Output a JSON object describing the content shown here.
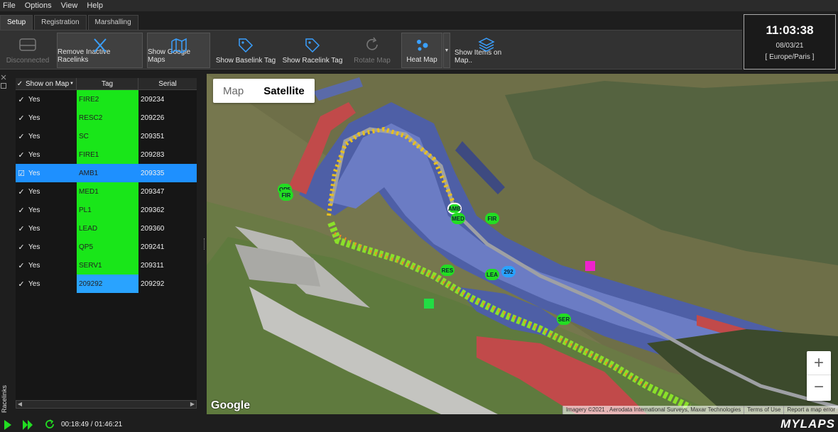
{
  "menu": [
    "File",
    "Options",
    "View",
    "Help"
  ],
  "tabs": [
    "Setup",
    "Registration",
    "Marshalling"
  ],
  "toolbar": {
    "disconnected": "Disconnected",
    "remove_inactive": "Remove Inactive Racelinks",
    "show_google_maps": "Show Google Maps",
    "show_baselink": "Show Baselink Tag",
    "show_racelink": "Show Racelink Tag",
    "rotate_map": "Rotate Map",
    "heat_map": "Heat Map",
    "show_items": "Show Items on Map.."
  },
  "clock": {
    "time": "11:03:38",
    "date": "08/03/21",
    "timezone": "[ Europe/Paris ]"
  },
  "table": {
    "columns": [
      "Show on Map",
      "Tag",
      "Serial"
    ],
    "rows": [
      {
        "show": "Yes",
        "tag": "FIRE2",
        "serial": "209234",
        "tag_color": "#19e619"
      },
      {
        "show": "Yes",
        "tag": "RESC2",
        "serial": "209226",
        "tag_color": "#19e619"
      },
      {
        "show": "Yes",
        "tag": "SC",
        "serial": "209351",
        "tag_color": "#19e619"
      },
      {
        "show": "Yes",
        "tag": "FIRE1",
        "serial": "209283",
        "tag_color": "#19e619"
      },
      {
        "show": "Yes",
        "tag": "AMB1",
        "serial": "209335",
        "tag_color": "#1e90ff",
        "selected": true
      },
      {
        "show": "Yes",
        "tag": "MED1",
        "serial": "209347",
        "tag_color": "#19e619"
      },
      {
        "show": "Yes",
        "tag": "PL1",
        "serial": "209362",
        "tag_color": "#19e619"
      },
      {
        "show": "Yes",
        "tag": "LEAD",
        "serial": "209360",
        "tag_color": "#19e619"
      },
      {
        "show": "Yes",
        "tag": "QP5",
        "serial": "209241",
        "tag_color": "#19e619"
      },
      {
        "show": "Yes",
        "tag": "SERV1",
        "serial": "209311",
        "tag_color": "#19e619"
      },
      {
        "show": "Yes",
        "tag": "209292",
        "serial": "209292",
        "tag_color": "#29a3ff"
      }
    ]
  },
  "side_tab": "Racelinks",
  "map": {
    "type_map": "Map",
    "type_satellite": "Satellite",
    "zoom_in": "+",
    "zoom_out": "−",
    "google": "Google",
    "attribution": [
      "Imagery ©2021 , Aerodata International Surveys, Maxar Technologies",
      "Terms of Use",
      "Report a map error"
    ],
    "markers": [
      {
        "label": "QP5",
        "color": "#22dd22"
      },
      {
        "label": "FIR",
        "color": "#22dd22"
      },
      {
        "label": "AMB",
        "color": "#22dd22"
      },
      {
        "label": "MED",
        "color": "#22dd22"
      },
      {
        "label": "FIR",
        "color": "#22dd22"
      },
      {
        "label": "RES",
        "color": "#22dd22"
      },
      {
        "label": "LEA",
        "color": "#22dd22"
      },
      {
        "label": "292",
        "color": "#29a3ff"
      },
      {
        "label": "SER",
        "color": "#22dd22"
      }
    ]
  },
  "playback": {
    "time": "00:18:49 / 01:46:21"
  },
  "brand": "MYLAPS"
}
